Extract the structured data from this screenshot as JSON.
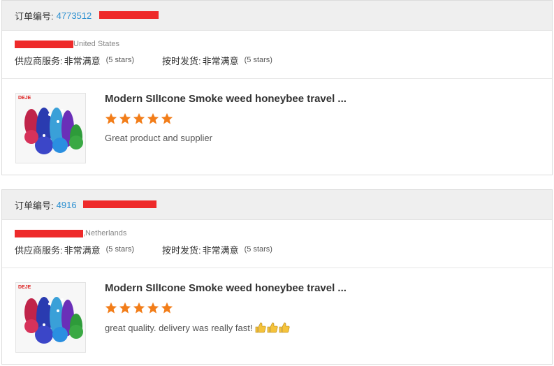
{
  "colors": {
    "order_id": "#2a8fd0",
    "star": "#f27d19",
    "redaction": "#ee2a2a",
    "header_bg": "#efefef"
  },
  "labels": {
    "order_number": "订单编号:",
    "supplier_service": "供应商服务:",
    "on_time_shipping": "按时发货:"
  },
  "reviews": [
    {
      "order_id_visible": "4773512",
      "country": "United States",
      "supplier_service_value": "非常满意",
      "supplier_service_stars": "(5 stars)",
      "on_time_value": "非常满意",
      "on_time_stars": "(5 stars)",
      "product_title": "Modern SIlIcone Smoke weed honeybee travel ...",
      "product_brand": "DEJE",
      "rating": 5,
      "review_text": "Great product and supplier",
      "thumbs_up_icons": 0
    },
    {
      "order_id_visible": "4916",
      "country": ",Netherlands",
      "supplier_service_value": "非常满意",
      "supplier_service_stars": "(5 stars)",
      "on_time_value": "非常满意",
      "on_time_stars": "(5 stars)",
      "product_title": "Modern SIlIcone Smoke weed honeybee travel ...",
      "product_brand": "DEJE",
      "rating": 5,
      "review_text": "great quality. delivery was really fast!",
      "thumbs_up_icons": 3
    }
  ]
}
